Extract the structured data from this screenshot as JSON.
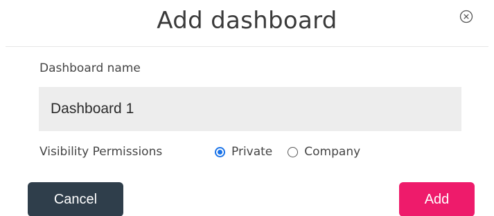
{
  "dialog": {
    "title": "Add dashboard",
    "close_icon": "close-circle-icon"
  },
  "form": {
    "name_label": "Dashboard name",
    "name_value": "Dashboard 1",
    "visibility_label": "Visibility Permissions",
    "visibility_options": [
      {
        "label": "Private",
        "selected": true
      },
      {
        "label": "Company",
        "selected": false
      }
    ]
  },
  "actions": {
    "cancel_label": "Cancel",
    "add_label": "Add"
  },
  "colors": {
    "cancel_button": "#2f3e4b",
    "add_button": "#ee1b6b",
    "radio_selected": "#1a73e8",
    "input_background": "#ededed"
  }
}
